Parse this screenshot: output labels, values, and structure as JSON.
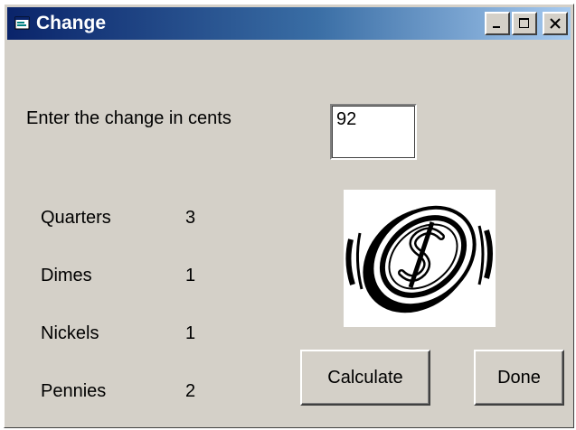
{
  "window": {
    "title": "Change",
    "icon": "form-icon",
    "controls": [
      "minimize-icon",
      "maximize-icon",
      "close-icon"
    ]
  },
  "form": {
    "prompt_label": "Enter the change in cents",
    "cents_value": "92",
    "results": [
      {
        "label": "Quarters",
        "value": "3"
      },
      {
        "label": "Dimes",
        "value": "1"
      },
      {
        "label": "Nickels",
        "value": "1"
      },
      {
        "label": "Pennies",
        "value": "2"
      }
    ],
    "image": "dollar-coin-icon",
    "calculate_label": "Calculate",
    "done_label": "Done"
  }
}
